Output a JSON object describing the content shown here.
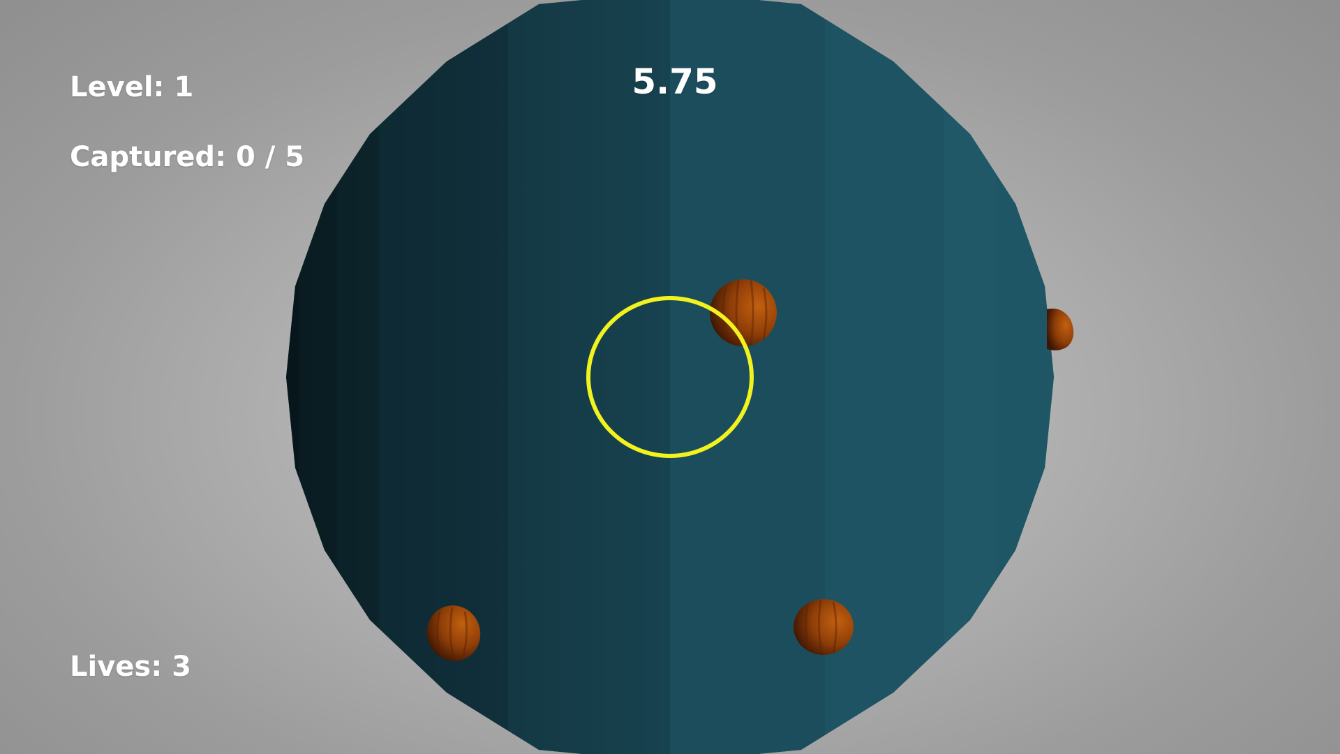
{
  "hud": {
    "level_label": "Level: 1",
    "captured_label": "Captured: 0 / 5",
    "lives_label": "Lives: 3",
    "timer": "5.75"
  },
  "game_state": {
    "level": 1,
    "captured": 0,
    "capture_goal": 5,
    "lives": 3,
    "time_remaining": 5.75,
    "critters_visible": 4
  },
  "colors": {
    "background": "#a8a8a8",
    "planet": "#1a4f5e",
    "capture_ring": "#f2f21f",
    "critter": "#a8470b",
    "hud_text": "#ffffff"
  },
  "icons": {
    "capture_ring": "ring-icon",
    "critter": "orange-ball-icon"
  }
}
